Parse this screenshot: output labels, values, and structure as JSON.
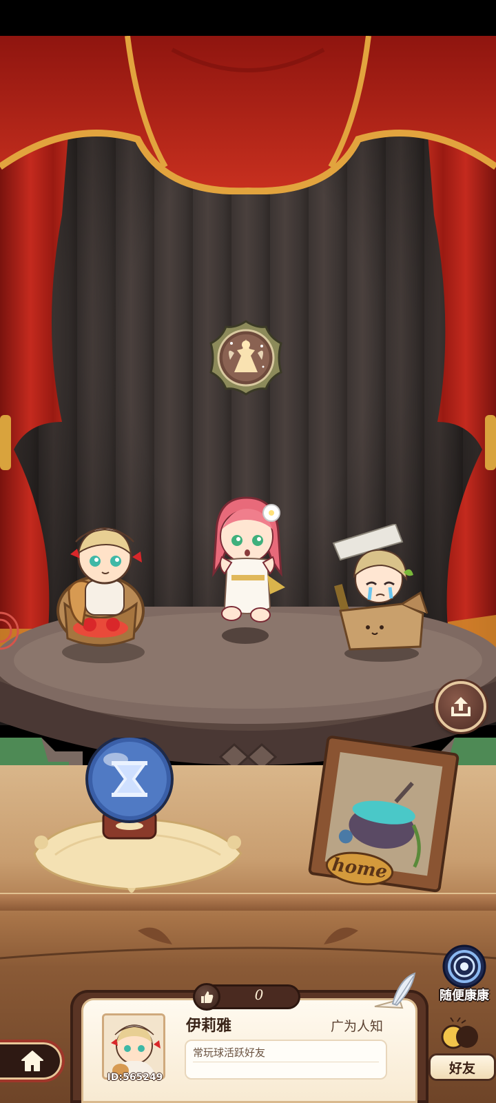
{
  "player": {
    "name": "伊莉雅",
    "id": "ID:565249",
    "fame": "广为人知",
    "bio": "常玩球活跃好友"
  },
  "likes": {
    "count": "0"
  },
  "buttons": {
    "random_visit": "随便康康",
    "friends": "好友"
  },
  "home_sign": "home",
  "icons": {
    "emblem": "fairy-emblem-icon",
    "hourglass": "hourglass-icon",
    "share": "share-icon",
    "home": "home-icon",
    "thumbs_up": "thumbs-up-icon",
    "quill": "quill-icon",
    "portal": "portal-icon"
  },
  "colors": {
    "curtain": "#b8261c",
    "curtain_trim": "#e2a43e",
    "stage_floor": "#7f6a62",
    "orb": "#3a5fa8"
  }
}
